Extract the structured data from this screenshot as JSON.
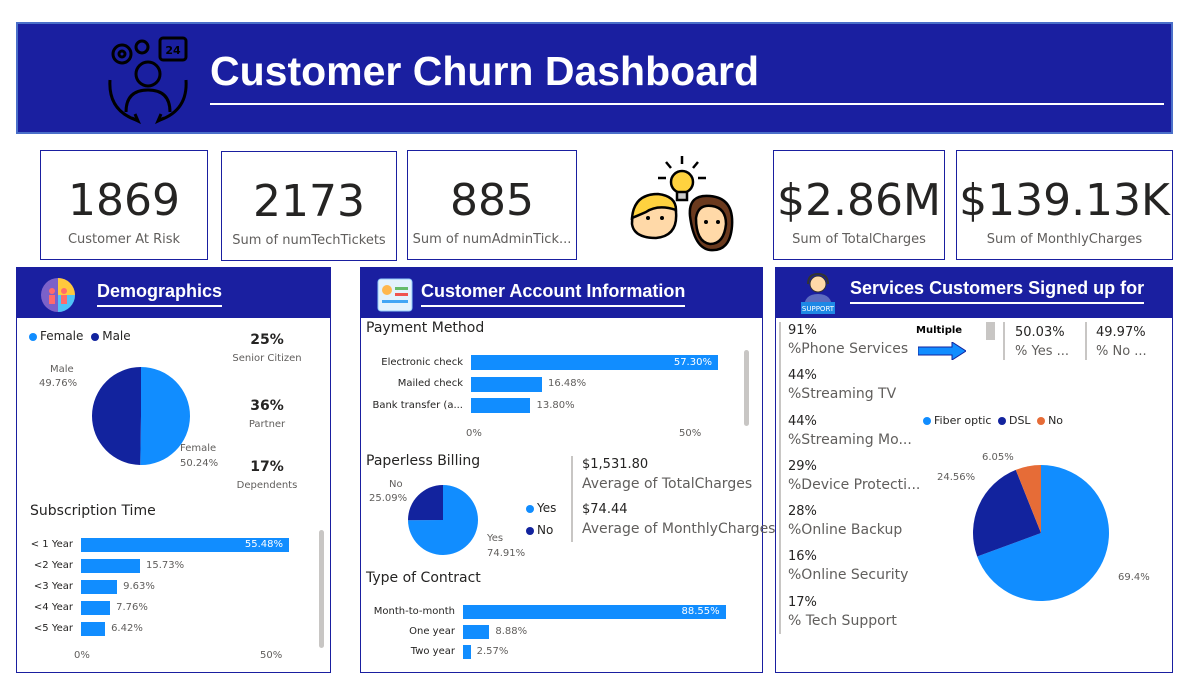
{
  "header": {
    "title": "Customer Churn Dashboard",
    "icon": "customer-support-cycle-icon"
  },
  "kpis": [
    {
      "value": "1869",
      "label": "Customer At Risk"
    },
    {
      "value": "2173",
      "label": "Sum of numTechTickets"
    },
    {
      "value": "885",
      "label": "Sum of numAdminTick..."
    },
    {
      "value": "$2.86M",
      "label": "Sum of TotalCharges"
    },
    {
      "value": "$139.13K",
      "label": "Sum of MonthlyCharges"
    }
  ],
  "demographics": {
    "title": "Demographics",
    "legend": [
      "Female",
      "Male"
    ],
    "gender_pie": {
      "male_label": "Male",
      "male_pct": "49.76%",
      "female_label": "Female",
      "female_pct": "50.24%"
    },
    "stats": [
      {
        "value": "25%",
        "label": "Senior Citizen"
      },
      {
        "value": "36%",
        "label": "Partner"
      },
      {
        "value": "17%",
        "label": "Dependents"
      }
    ],
    "subscription_title": "Subscription Time",
    "axis": [
      "0%",
      "50%"
    ]
  },
  "account": {
    "title": "Customer Account Information",
    "payment_title": "Payment Method",
    "payment_axis": [
      "0%",
      "50%"
    ],
    "paperless_title": "Paperless Billing",
    "paperless_pie": {
      "no_label": "No",
      "no_pct": "25.09%",
      "yes_label": "Yes",
      "yes_pct": "74.91%"
    },
    "paperless_legend": [
      "Yes",
      "No"
    ],
    "avg_total": {
      "value": "$1,531.80",
      "label": "Average of TotalCharges"
    },
    "avg_monthly": {
      "value": "$74.44",
      "label": "Average of MonthlyCharges"
    },
    "contract_title": "Type of Contract"
  },
  "services": {
    "title": "Services Customers Signed up for",
    "list": [
      {
        "value": "91%",
        "label": "%Phone Services"
      },
      {
        "value": "44%",
        "label": "%Streaming TV"
      },
      {
        "value": "44%",
        "label": "%Streaming Mo..."
      },
      {
        "value": "29%",
        "label": "%Device Protecti..."
      },
      {
        "value": "28%",
        "label": "%Online Backup"
      },
      {
        "value": "16%",
        "label": "%Online Security"
      },
      {
        "value": "17%",
        "label": "% Tech Support"
      }
    ],
    "multiple_label": "Multiple",
    "multiple_yes": {
      "value": "50.03%",
      "label": "% Yes ..."
    },
    "multiple_no": {
      "value": "49.97%",
      "label": "% No ..."
    },
    "internet_legend": [
      "Fiber optic",
      "DSL",
      "No"
    ],
    "internet_pie_labels": {
      "no": "6.05%",
      "dsl": "24.56%",
      "fiber": "69.4%"
    }
  },
  "colors": {
    "brand": "#1a1fa0",
    "bar": "#118dff",
    "navy": "#12239e",
    "orange": "#e66c37"
  },
  "chart_data": [
    {
      "type": "pie",
      "name": "gender",
      "labels": [
        "Female",
        "Male"
      ],
      "values": [
        50.24,
        49.76
      ]
    },
    {
      "type": "bar",
      "name": "subscription_time",
      "title": "Subscription Time",
      "categories": [
        "< 1 Year",
        "<2 Year",
        "<3 Year",
        "<4 Year",
        "<5 Year"
      ],
      "values": [
        55.48,
        15.73,
        9.63,
        7.76,
        6.42
      ],
      "labels": [
        "55.48%",
        "15.73%",
        "9.63%",
        "7.76%",
        "6.42%"
      ],
      "xlim": [
        0,
        56
      ]
    },
    {
      "type": "bar",
      "name": "payment_method",
      "title": "Payment Method",
      "categories": [
        "Electronic check",
        "Mailed check",
        "Bank transfer (a..."
      ],
      "values": [
        57.3,
        16.48,
        13.8
      ],
      "labels": [
        "57.30%",
        "16.48%",
        "13.80%"
      ],
      "xlim": [
        0,
        58
      ]
    },
    {
      "type": "pie",
      "name": "paperless_billing",
      "labels": [
        "Yes",
        "No"
      ],
      "values": [
        74.91,
        25.09
      ]
    },
    {
      "type": "bar",
      "name": "contract_type",
      "title": "Type of Contract",
      "categories": [
        "Month-to-month",
        "One year",
        "Two year"
      ],
      "values": [
        88.55,
        8.88,
        2.57
      ],
      "labels": [
        "88.55%",
        "8.88%",
        "2.57%"
      ],
      "xlim": [
        0,
        89
      ]
    },
    {
      "type": "pie",
      "name": "internet_service",
      "labels": [
        "Fiber optic",
        "DSL",
        "No"
      ],
      "values": [
        69.4,
        24.56,
        6.05
      ]
    }
  ]
}
